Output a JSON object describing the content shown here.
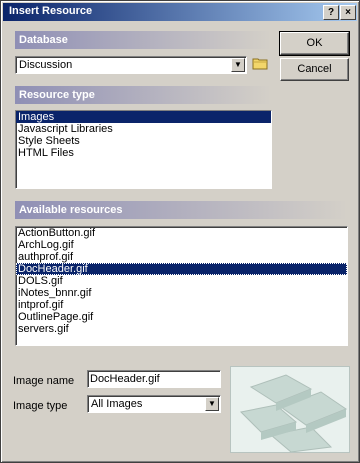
{
  "window": {
    "title": "Insert Resource",
    "help_label": "?",
    "close_label": "×"
  },
  "buttons": {
    "ok": "OK",
    "cancel": "Cancel"
  },
  "database": {
    "header": "Database",
    "value": "Discussion"
  },
  "resource_type": {
    "header": "Resource type",
    "items": [
      "Images",
      "Javascript Libraries",
      "Style Sheets",
      "HTML Files"
    ],
    "selected_index": 0
  },
  "available": {
    "header": "Available resources",
    "items": [
      "ActionButton.gif",
      "ArchLog.gif",
      "authprof.gif",
      "DocHeader.gif",
      "DOLS.gif",
      "iNotes_bnnr.gif",
      "intprof.gif",
      "OutlinePage.gif",
      "servers.gif"
    ],
    "selected_index": 3
  },
  "image_name": {
    "label": "Image name",
    "value": "DocHeader.gif"
  },
  "image_type": {
    "label": "Image type",
    "value": "All Images"
  },
  "colors": {
    "title_start": "#0a246a",
    "title_end": "#a6caf0",
    "selection": "#0a246a",
    "dialog_bg": "#d4d0c8"
  }
}
